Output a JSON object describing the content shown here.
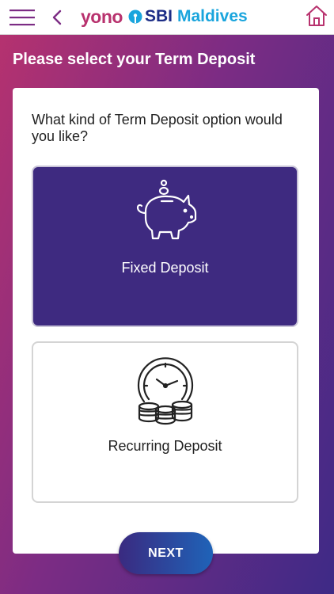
{
  "header": {
    "brand_yono": "yono",
    "brand_sbi": "SBI",
    "brand_location": "Maldives",
    "icons": [
      "menu-icon",
      "back-icon",
      "sbi-logo-icon",
      "home-icon"
    ]
  },
  "page": {
    "title": "Please select your Term Deposit",
    "question": "What kind of Term Deposit option would you like?"
  },
  "options": [
    {
      "label": "Fixed Deposit",
      "icon": "piggy-bank-icon",
      "selected": true
    },
    {
      "label": "Recurring Deposit",
      "icon": "clock-coins-icon",
      "selected": false
    }
  ],
  "actions": {
    "next_label": "NEXT"
  },
  "colors": {
    "brand_pink": "#b8326e",
    "brand_navy": "#1c2d86",
    "brand_cyan": "#1aa5dd",
    "selected_card": "#3e2a80",
    "background_start": "#b8326e",
    "background_end": "#3e2a86"
  }
}
